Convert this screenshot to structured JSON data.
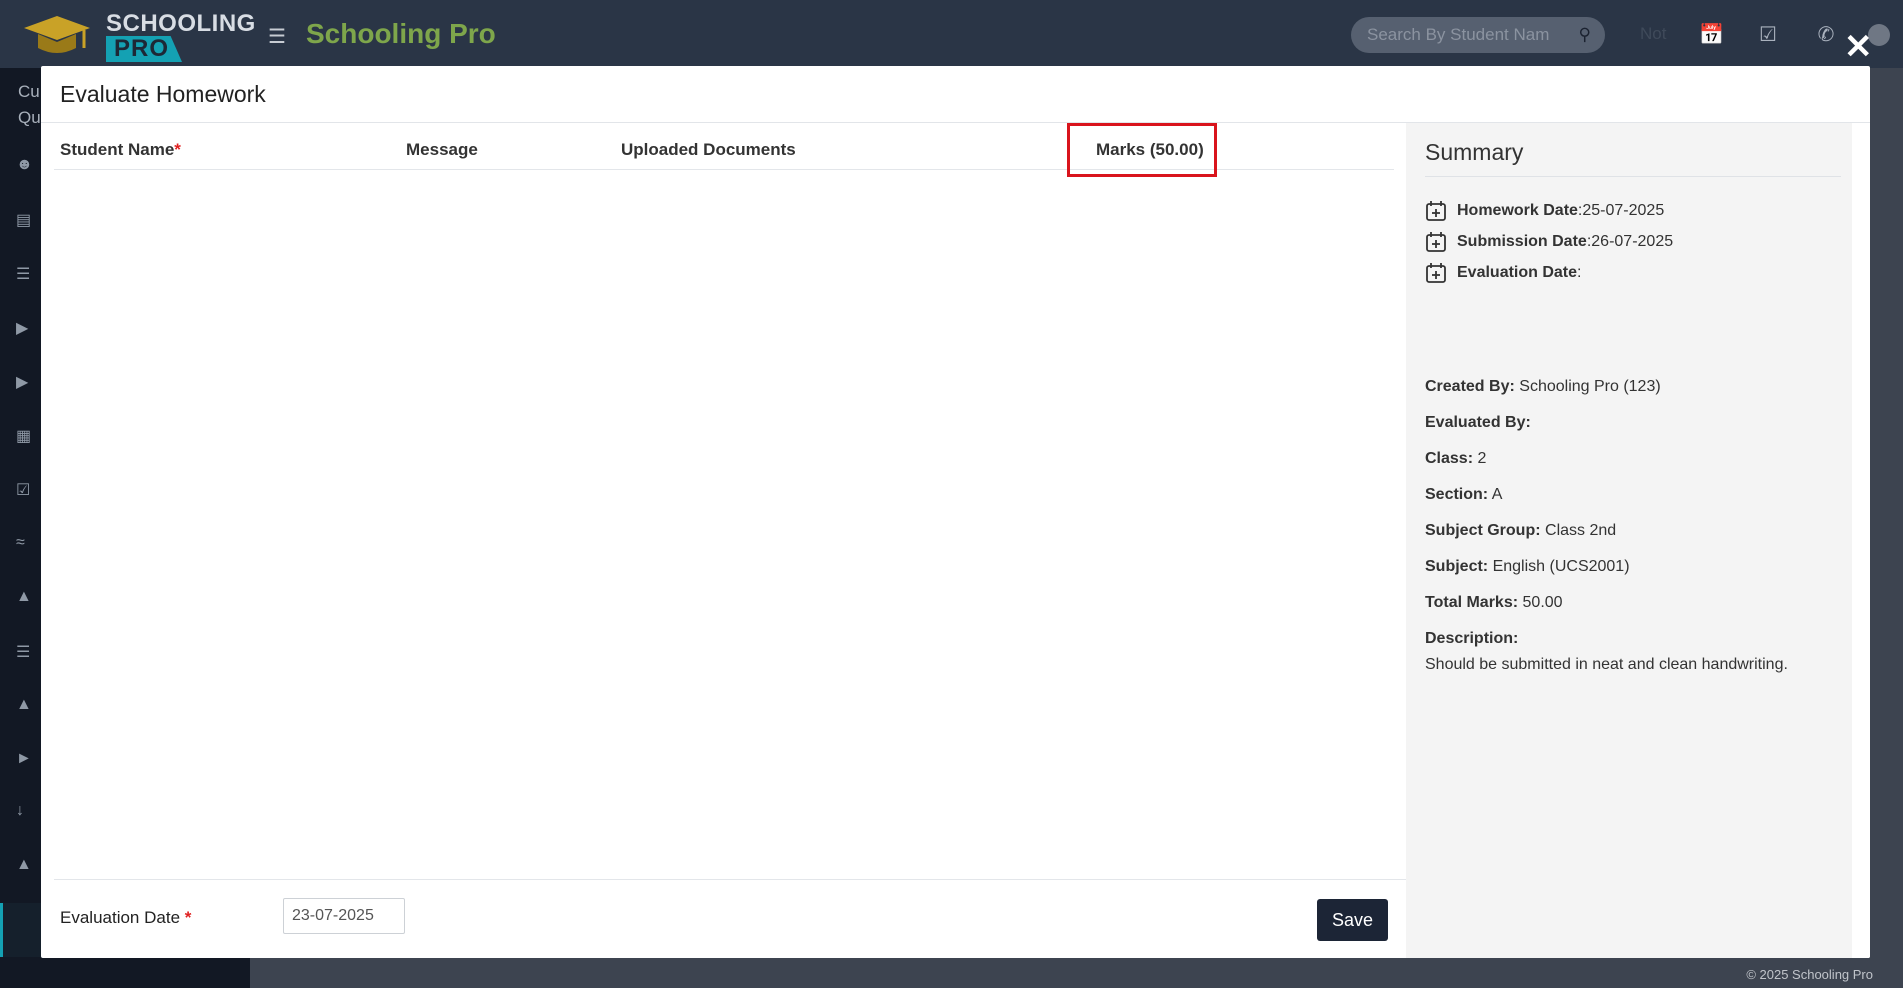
{
  "app": {
    "logo_line1": "SCHOOLING",
    "logo_line2": "PRO",
    "brand": "Schooling Pro",
    "search_placeholder": "Search By Student Nam",
    "top_dim_text": "Not",
    "footer": "© 2025 Schooling Pro",
    "sidebar_text": [
      "Cu",
      "Qu"
    ]
  },
  "modal": {
    "title": "Evaluate Homework",
    "close_icon": "close-icon",
    "table": {
      "columns": {
        "student_name": "Student Name",
        "required_mark": "*",
        "message": "Message",
        "uploaded_documents": "Uploaded Documents",
        "marks": "Marks (50.00)"
      },
      "rows": []
    },
    "footer": {
      "evaluation_date_label": "Evaluation Date",
      "required_mark": "*",
      "evaluation_date_value": "23-07-2025",
      "save_label": "Save"
    }
  },
  "summary": {
    "title": "Summary",
    "homework_date_label": "Homework Date",
    "homework_date_value": "25-07-2025",
    "submission_date_label": "Submission Date",
    "submission_date_value": "26-07-2025",
    "evaluation_date_label": "Evaluation Date",
    "evaluation_date_value": "",
    "colon": ":",
    "created_by_label": "Created By:",
    "created_by_value": "Schooling Pro (123)",
    "evaluated_by_label": "Evaluated By:",
    "evaluated_by_value": "",
    "class_label": "Class:",
    "class_value": "2",
    "section_label": "Section:",
    "section_value": "A",
    "subject_group_label": "Subject Group:",
    "subject_group_value": "Class 2nd",
    "subject_label": "Subject:",
    "subject_value": "English (UCS2001)",
    "total_marks_label": "Total Marks:",
    "total_marks_value": "50.00",
    "description_label": "Description:",
    "description_value": "Should be submitted in neat and clean handwriting."
  },
  "colors": {
    "brand_green": "#7ea64b",
    "accent_teal": "#14a1b3",
    "highlight_red": "#d9141c",
    "save_button": "#1c2536"
  }
}
